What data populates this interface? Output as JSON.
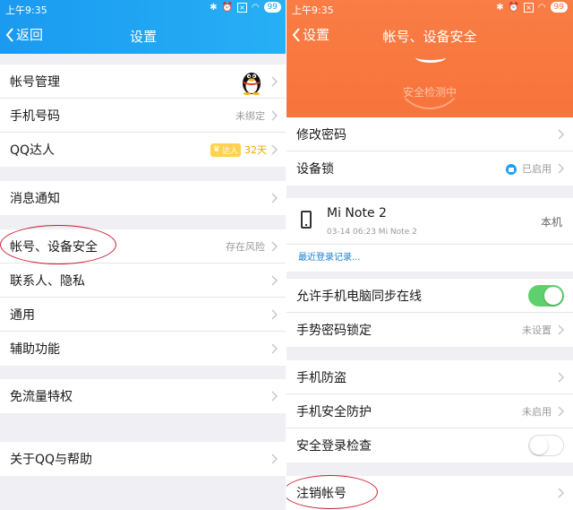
{
  "left": {
    "status": {
      "time": "上午9:35",
      "battery": "99"
    },
    "nav": {
      "back_label": "返回",
      "title": "设置"
    },
    "groups": [
      {
        "rows": [
          {
            "label": "帐号管理",
            "value": ""
          },
          {
            "label": "手机号码",
            "value": "未绑定"
          },
          {
            "label": "QQ达人",
            "value": "32天",
            "badge": "达人"
          }
        ]
      },
      {
        "rows": [
          {
            "label": "消息通知",
            "value": ""
          }
        ]
      },
      {
        "rows": [
          {
            "label": "帐号、设备安全",
            "value": "存在风险"
          },
          {
            "label": "联系人、隐私",
            "value": ""
          },
          {
            "label": "通用",
            "value": ""
          },
          {
            "label": "辅助功能",
            "value": ""
          }
        ]
      },
      {
        "rows": [
          {
            "label": "免流量特权",
            "value": ""
          }
        ]
      },
      {
        "rows": [
          {
            "label": "关于QQ与帮助",
            "value": ""
          }
        ]
      }
    ]
  },
  "right": {
    "status": {
      "time": "上午9:35",
      "battery": "99"
    },
    "nav": {
      "back_label": "设置",
      "title": "帐号、设备安全"
    },
    "scan_text": "安全检测中",
    "group1": [
      {
        "label": "修改密码",
        "value": ""
      },
      {
        "label": "设备锁",
        "value": "已启用"
      }
    ],
    "device": {
      "name": "Mi Note 2",
      "meta": "03-14 06:23 Mi Note 2",
      "self_label": "本机",
      "recent_link": "最近登录记录..."
    },
    "group2": [
      {
        "label": "允许手机电脑同步在线",
        "toggle": "on"
      },
      {
        "label": "手势密码锁定",
        "value": "未设置"
      }
    ],
    "group3": [
      {
        "label": "手机防盗",
        "value": ""
      },
      {
        "label": "手机安全防护",
        "value": "未启用"
      },
      {
        "label": "安全登录检查",
        "toggle": "off"
      }
    ],
    "group4": [
      {
        "label": "注销帐号",
        "value": ""
      }
    ]
  },
  "colors": {
    "blue_header": "#1ea0f0",
    "orange_header": "#f7743b",
    "toggle_on": "#5ed06e",
    "annotation": "#c8202f"
  }
}
